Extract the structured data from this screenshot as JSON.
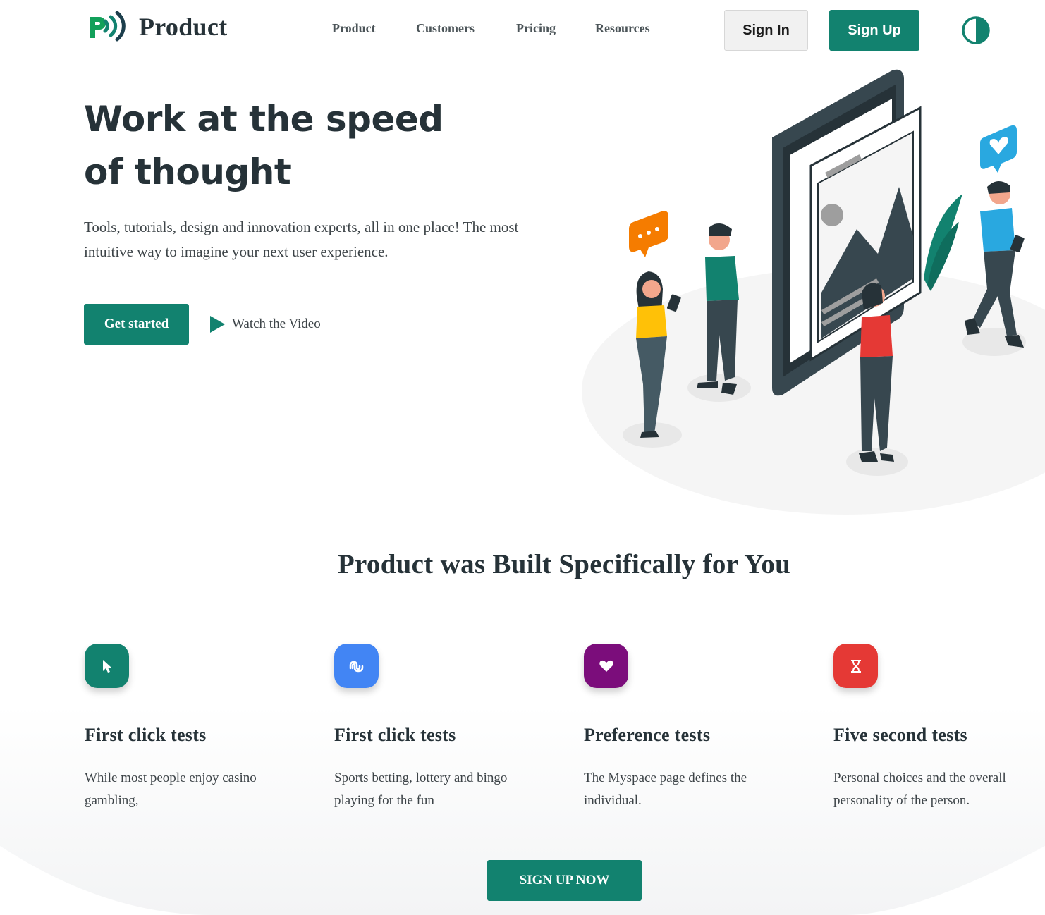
{
  "brand": {
    "name": "Product",
    "accent": "#12826f"
  },
  "nav": {
    "items": [
      "Product",
      "Customers",
      "Pricing",
      "Resources"
    ]
  },
  "header": {
    "signin_label": "Sign In",
    "signup_label": "Sign Up",
    "theme_icon": "contrast-icon"
  },
  "hero": {
    "title": "Work at the speed of thought",
    "text": "Tools, tutorials, design and innovation experts, all in one place! The most intuitive way to imagine your next user experience.",
    "cta_label": "Get started",
    "video_label": "Watch the Video"
  },
  "features": {
    "title": "Product was Built Specifically for You",
    "items": [
      {
        "icon": "cursor-icon",
        "color": "#12826f",
        "title": "First click tests",
        "text": "While most people enjoy casino gambling,"
      },
      {
        "icon": "stumbleupon-icon",
        "color": "#4285f4",
        "title": "First click tests",
        "text": "Sports betting, lottery and bingo playing for the fun"
      },
      {
        "icon": "heart-icon",
        "color": "#7b0d7b",
        "title": "Preference tests",
        "text": "The Myspace page defines the individual."
      },
      {
        "icon": "hourglass-icon",
        "color": "#e53935",
        "title": "Five second tests",
        "text": "Personal choices and the overall personality of the person."
      }
    ],
    "cta_label": "SIGN UP NOW"
  }
}
